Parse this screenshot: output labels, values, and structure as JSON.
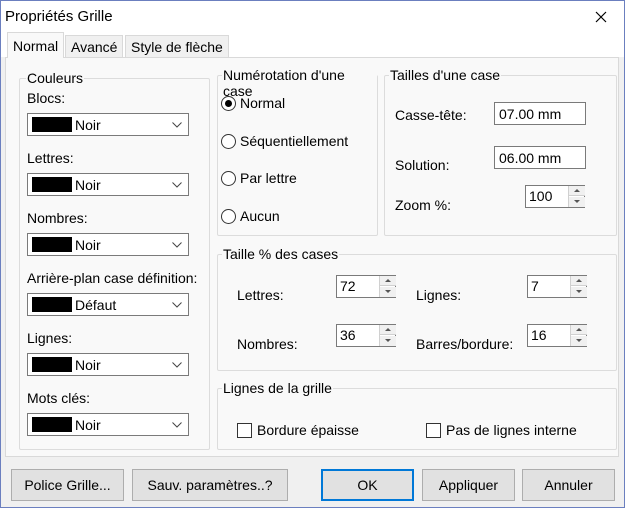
{
  "window": {
    "title": "Propriétés Grille",
    "close_icon": "close-icon"
  },
  "tabs": [
    {
      "label": "Normal",
      "active": true
    },
    {
      "label": "Avancé",
      "active": false
    },
    {
      "label": "Style de flèche",
      "active": false
    }
  ],
  "couleurs": {
    "title": "Couleurs",
    "items": [
      {
        "label": "Blocs:",
        "value": "Noir"
      },
      {
        "label": "Lettres:",
        "value": "Noir"
      },
      {
        "label": "Nombres:",
        "value": "Noir"
      },
      {
        "label": "Arrière-plan case définition:",
        "value": "Défaut"
      },
      {
        "label": "Lignes:",
        "value": "Noir"
      },
      {
        "label": "Mots clés:",
        "value": "Noir"
      }
    ],
    "swatch_color": "#000000"
  },
  "numerotation": {
    "title": "Numérotation d'une case",
    "options": [
      {
        "label": "Normal",
        "selected": true
      },
      {
        "label": "Séquentiellement",
        "selected": false
      },
      {
        "label": "Par lettre",
        "selected": false
      },
      {
        "label": "Aucun",
        "selected": false
      }
    ]
  },
  "tailles": {
    "title": "Tailles d'une case",
    "casse_tete_label": "Casse-tête:",
    "casse_tete_value": "07.00 mm",
    "solution_label": "Solution:",
    "solution_value": "06.00 mm",
    "zoom_label": "Zoom %:",
    "zoom_value": "100"
  },
  "taille_pct": {
    "title": "Taille % des cases",
    "lettres_label": "Lettres:",
    "lettres_value": "72",
    "nombres_label": "Nombres:",
    "nombres_value": "36",
    "lignes_label": "Lignes:",
    "lignes_value": "7",
    "barres_label": "Barres/bordure:",
    "barres_value": "16"
  },
  "lignes_grille": {
    "title": "Lignes de la grille",
    "bordure_label": "Bordure épaisse",
    "bordure_checked": false,
    "pas_lignes_label": "Pas de lignes interne",
    "pas_lignes_checked": false
  },
  "footer": {
    "police_label": "Police Grille...",
    "sauv_label": "Sauv. paramètres..?",
    "ok_label": "OK",
    "appliquer_label": "Appliquer",
    "annuler_label": "Annuler"
  },
  "colors": {
    "accent": "#0078d7",
    "window_border": "#6b7fbf"
  }
}
